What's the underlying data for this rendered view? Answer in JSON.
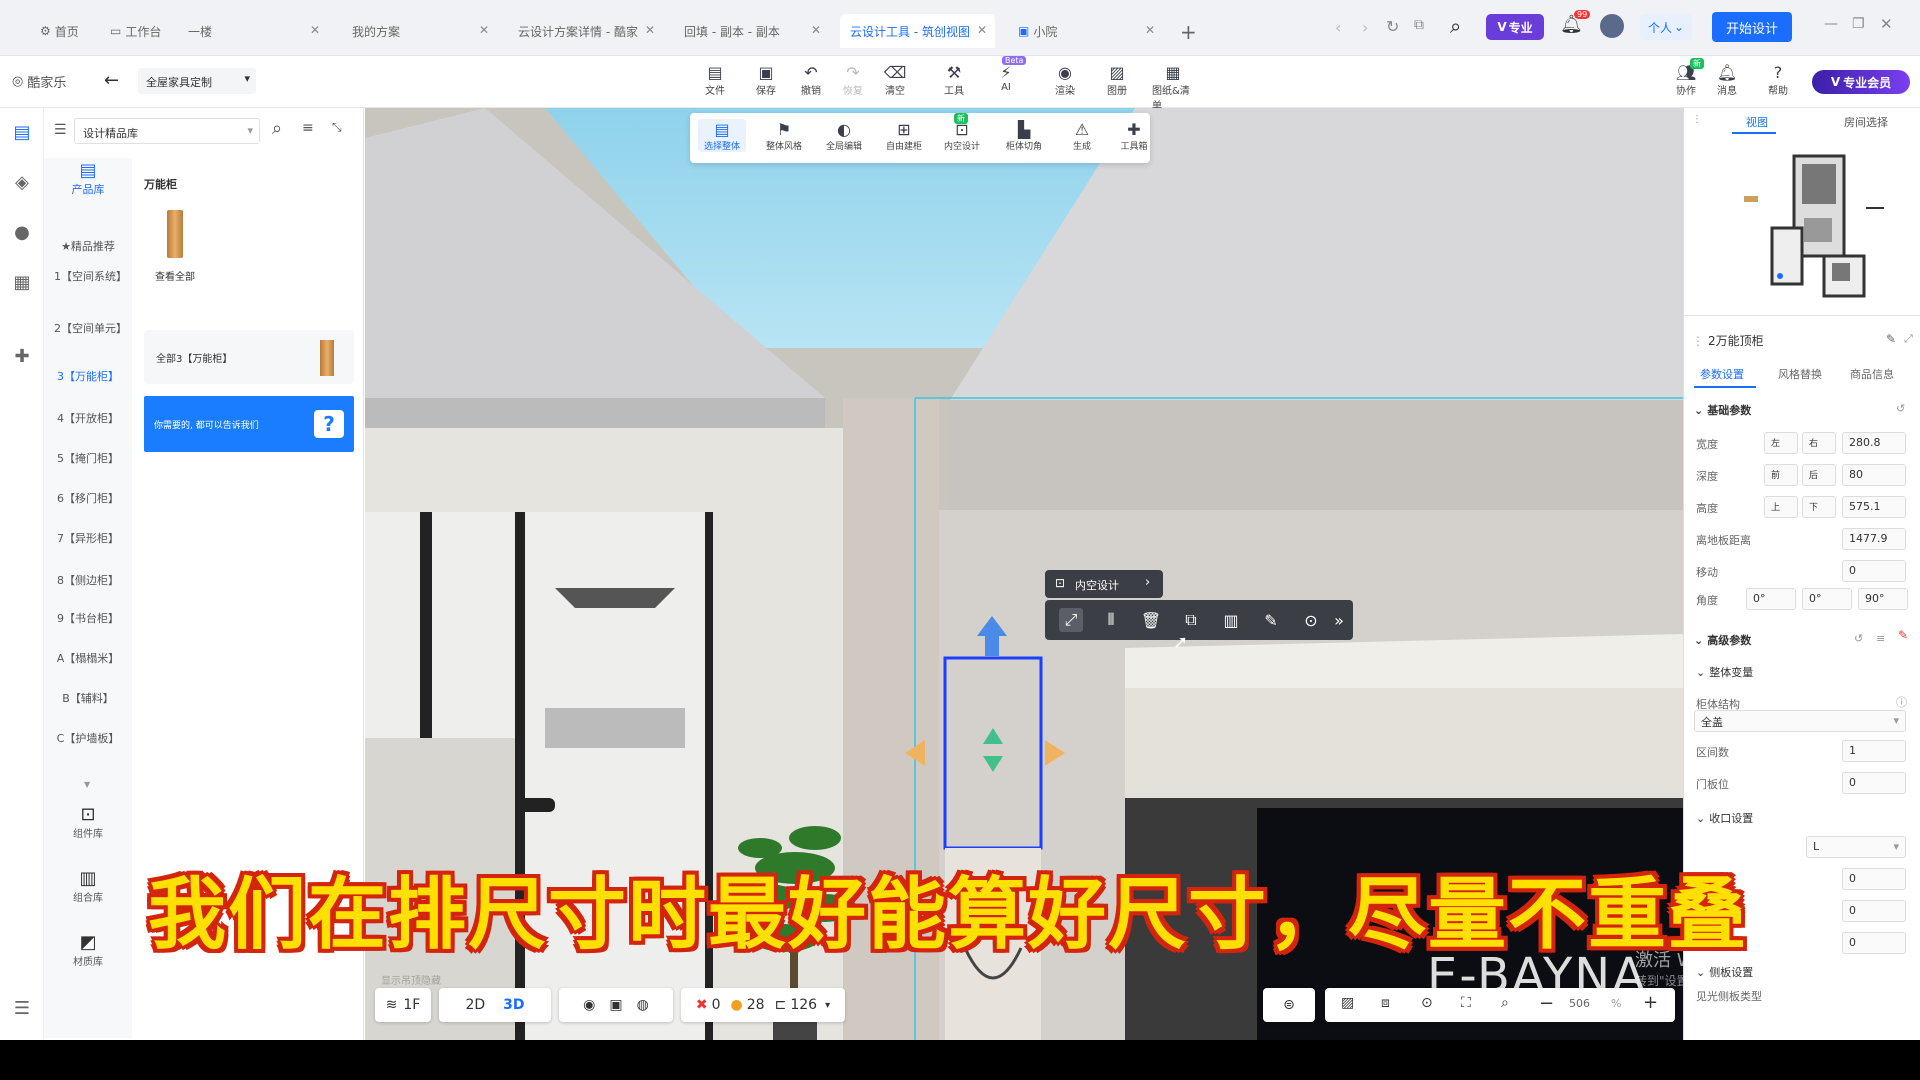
{
  "tabs": [
    {
      "label": "首页"
    },
    {
      "label": "工作台"
    },
    {
      "label": "一楼"
    },
    {
      "label": "我的方案"
    },
    {
      "label": "云设计方案详情 - 酷家"
    },
    {
      "label": "回填 - 副本 - 副本"
    },
    {
      "label": "云设计工具 - 筑创视图",
      "active": true
    },
    {
      "label": "小院"
    }
  ],
  "topright": {
    "pro_badge": "专业",
    "notif_count": "99",
    "personal": "个人",
    "start_design": "开始设计"
  },
  "menubar": {
    "logo": "酷家乐",
    "dropdown": "全屋家具定制",
    "tools": [
      "文件",
      "保存",
      "撤销",
      "恢复",
      "清空",
      "工具",
      "AI",
      "渲染",
      "图册",
      "图纸&清单"
    ],
    "ai_badge": "Beta",
    "right_tools": [
      "协作",
      "消息",
      "帮助"
    ],
    "right_badge": "新",
    "vip": "专业会员"
  },
  "subtoolbar": {
    "items": [
      "选择整体",
      "整体风格",
      "全局编辑",
      "自由建柜",
      "内空设计",
      "柜体切角",
      "生成",
      "工具箱"
    ],
    "new_badge": "新"
  },
  "leftpanel": {
    "library_name": "设计精品库",
    "tab_label": "产品库",
    "categories": [
      "★精品推荐",
      "1【空间系统】",
      "2【空间单元】",
      "3【万能柜】",
      "4【开放柜】",
      "5【掩门柜】",
      "6【移门柜】",
      "7【异形柜】",
      "8【侧边柜】",
      "9【书台柜】",
      "A【榻榻米】",
      "B【辅料】",
      "C【护墙板】"
    ],
    "bottom_tools": [
      "组件库",
      "组合库",
      "材质库"
    ],
    "section_title": "万能柜",
    "view_all": "查看全部",
    "all_item": "全部3【万能柜】",
    "help_text": "你需要的, 都可以告诉我们"
  },
  "viewport": {
    "context_label": "内空设计",
    "brand_text": "E-BAYNA",
    "watermark_line1": "激活 Windows",
    "watermark_line2": "转到\"设置\"以激活 Windows。",
    "bottom_left": {
      "floor": "1F",
      "mode2d": "2D",
      "mode3d": "3D",
      "errors": "0",
      "warnings": "28",
      "count": "126"
    },
    "zoom": "506",
    "zoom_unit": "%",
    "faint_text": "显示吊顶隐藏"
  },
  "caption": "我们在排尺寸时最好能算好尺寸，尽量不重叠",
  "rightpanel": {
    "tabs": [
      "视图",
      "房间选择"
    ],
    "object_title": "2万能顶柜",
    "prop_tabs": [
      "参数设置",
      "风格替换",
      "商品信息"
    ],
    "basic_section": "基础参数",
    "params": [
      {
        "label": "宽度",
        "value": "280.8",
        "opt1": "左",
        "opt2": "右"
      },
      {
        "label": "深度",
        "value": "80",
        "opt1": "前",
        "opt2": "后"
      },
      {
        "label": "高度",
        "value": "575.1",
        "opt1": "上",
        "opt2": "下"
      },
      {
        "label": "离地板距离",
        "value": "1477.9"
      },
      {
        "label": "移动",
        "value": "0"
      }
    ],
    "angle_label": "角度",
    "angles": [
      "0°",
      "0°",
      "90°"
    ],
    "advanced_section": "高级参数",
    "overall_section": "整体变量",
    "structure_label": "柜体结构",
    "structure_value": "全盖",
    "zone_label": "区间数",
    "zone_value": "1",
    "door_label": "门板位",
    "door_value": "0",
    "edge_section": "收口设置",
    "edge_value": "L",
    "edge_values": [
      "0",
      "0",
      "0"
    ],
    "side_section": "侧板设置",
    "side_label": "见光侧板类型"
  }
}
